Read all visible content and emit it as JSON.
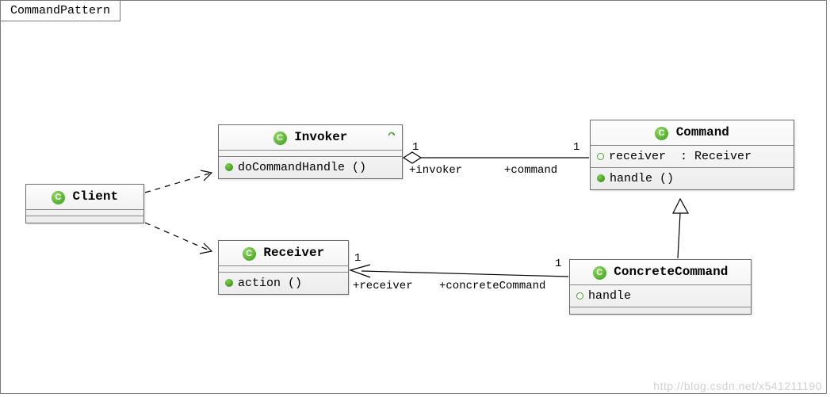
{
  "frame": {
    "title": "CommandPattern"
  },
  "classes": {
    "client": {
      "name": "Client"
    },
    "invoker": {
      "name": "Invoker",
      "op1": "doCommandHandle ()"
    },
    "receiver": {
      "name": "Receiver",
      "op1": "action ()"
    },
    "command": {
      "name": "Command",
      "attr1": "receiver  : Receiver",
      "op1": "handle ()"
    },
    "concrete": {
      "name": "ConcreteCommand",
      "attr1": "handle"
    }
  },
  "assoc": {
    "invokerCommand": {
      "m1": "1",
      "m2": "1",
      "r1": "+invoker",
      "r2": "+command"
    },
    "receiverConcrete": {
      "m1": "1",
      "m2": "1",
      "r1": "+receiver",
      "r2": "+concreteCommand"
    }
  },
  "watermark": "http://blog.csdn.net/x541211190"
}
